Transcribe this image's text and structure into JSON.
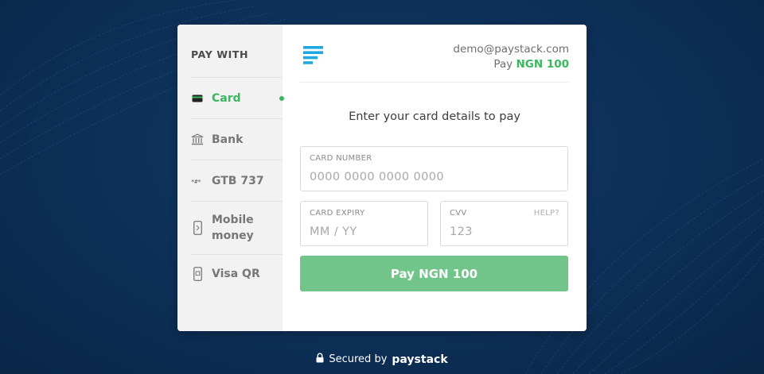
{
  "sidebar": {
    "title": "PAY WITH",
    "items": [
      {
        "label": "Card",
        "icon": "card-icon",
        "active": true
      },
      {
        "label": "Bank",
        "icon": "bank-icon",
        "active": false
      },
      {
        "label": "GTB 737",
        "icon": "ussd-icon",
        "active": false
      },
      {
        "label": "Mobile money",
        "icon": "mobile-phone-icon",
        "active": false
      },
      {
        "label": "Visa QR",
        "icon": "qr-phone-icon",
        "active": false
      }
    ]
  },
  "header": {
    "email": "demo@paystack.com",
    "pay_prefix": "Pay",
    "amount": "NGN 100"
  },
  "form": {
    "heading": "Enter your card details to pay",
    "card_number": {
      "label": "CARD NUMBER",
      "placeholder": "0000 0000 0000 0000"
    },
    "card_expiry": {
      "label": "CARD EXPIRY",
      "placeholder": "MM / YY"
    },
    "cvv": {
      "label": "CVV",
      "help": "HELP?",
      "placeholder": "123"
    },
    "pay_button": "Pay NGN 100"
  },
  "footer": {
    "secured_by": "Secured by",
    "brand": "paystack"
  },
  "colors": {
    "accent": "#3bb75e",
    "button": "#72c58a",
    "background": "#0d2f57",
    "logo": "#1ea8e0"
  }
}
